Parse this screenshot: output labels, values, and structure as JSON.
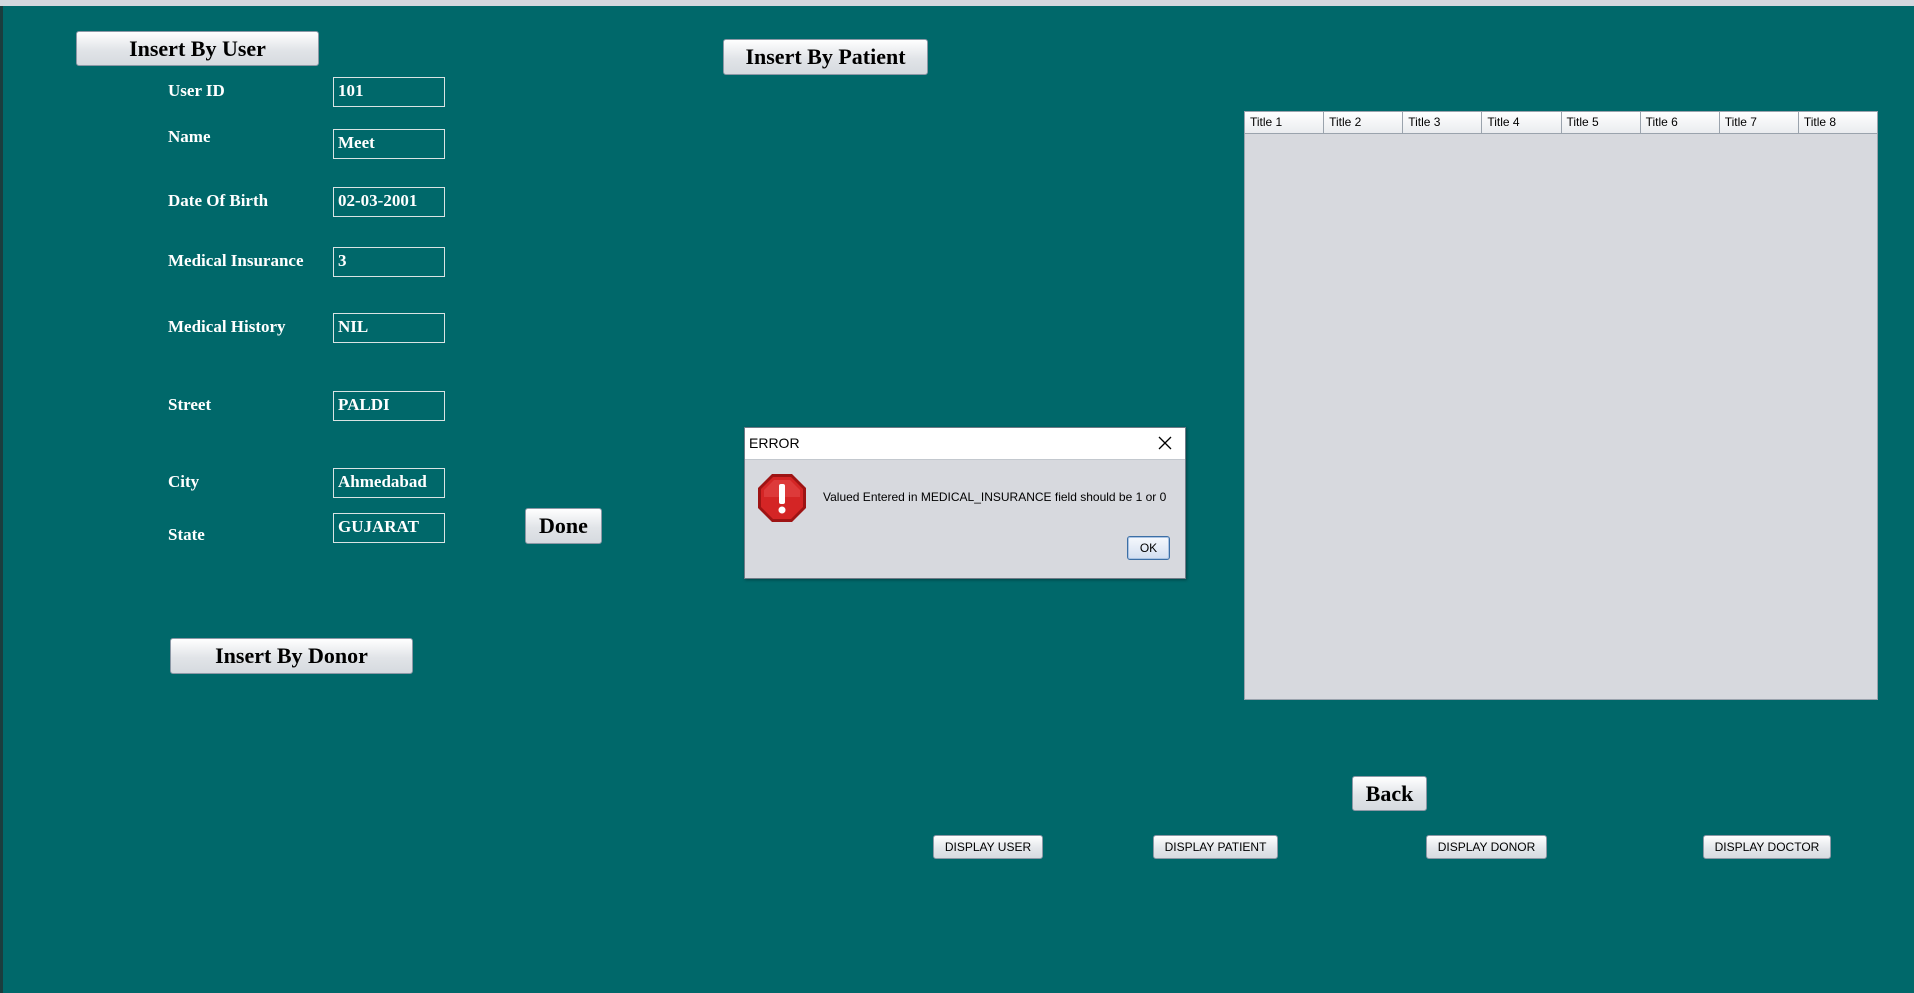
{
  "buttons": {
    "insert_by_user": "Insert By User",
    "insert_by_patient": "Insert By Patient",
    "insert_by_donor": "Insert By Donor",
    "done": "Done",
    "back": "Back",
    "display_user": "DISPLAY USER",
    "display_patient": "DISPLAY PATIENT",
    "display_donor": "DISPLAY DONOR",
    "display_doctor": "DISPLAY DOCTOR"
  },
  "form": {
    "user_id": {
      "label": "User ID",
      "value": "101"
    },
    "name": {
      "label": "Name",
      "value": "Meet"
    },
    "dob": {
      "label": "Date Of Birth",
      "value": "02-03-2001"
    },
    "medical_insurance": {
      "label": "Medical Insurance",
      "value": "3"
    },
    "medical_history": {
      "label": "Medical History",
      "value": "NIL"
    },
    "street": {
      "label": "Street",
      "value": "PALDI"
    },
    "city": {
      "label": "City",
      "value": "Ahmedabad"
    },
    "state": {
      "label": "State",
      "value": "GUJARAT"
    }
  },
  "table": {
    "columns": [
      "Title 1",
      "Title 2",
      "Title 3",
      "Title 4",
      "Title 5",
      "Title 6",
      "Title 7",
      "Title 8"
    ]
  },
  "dialog": {
    "title": "ERROR",
    "message": "Valued Entered in MEDICAL_INSURANCE field should be 1 or 0",
    "ok_label": "OK",
    "icon": "error-stop-icon"
  },
  "colors": {
    "background": "#00686a",
    "error_red": "#cc1f1f"
  }
}
